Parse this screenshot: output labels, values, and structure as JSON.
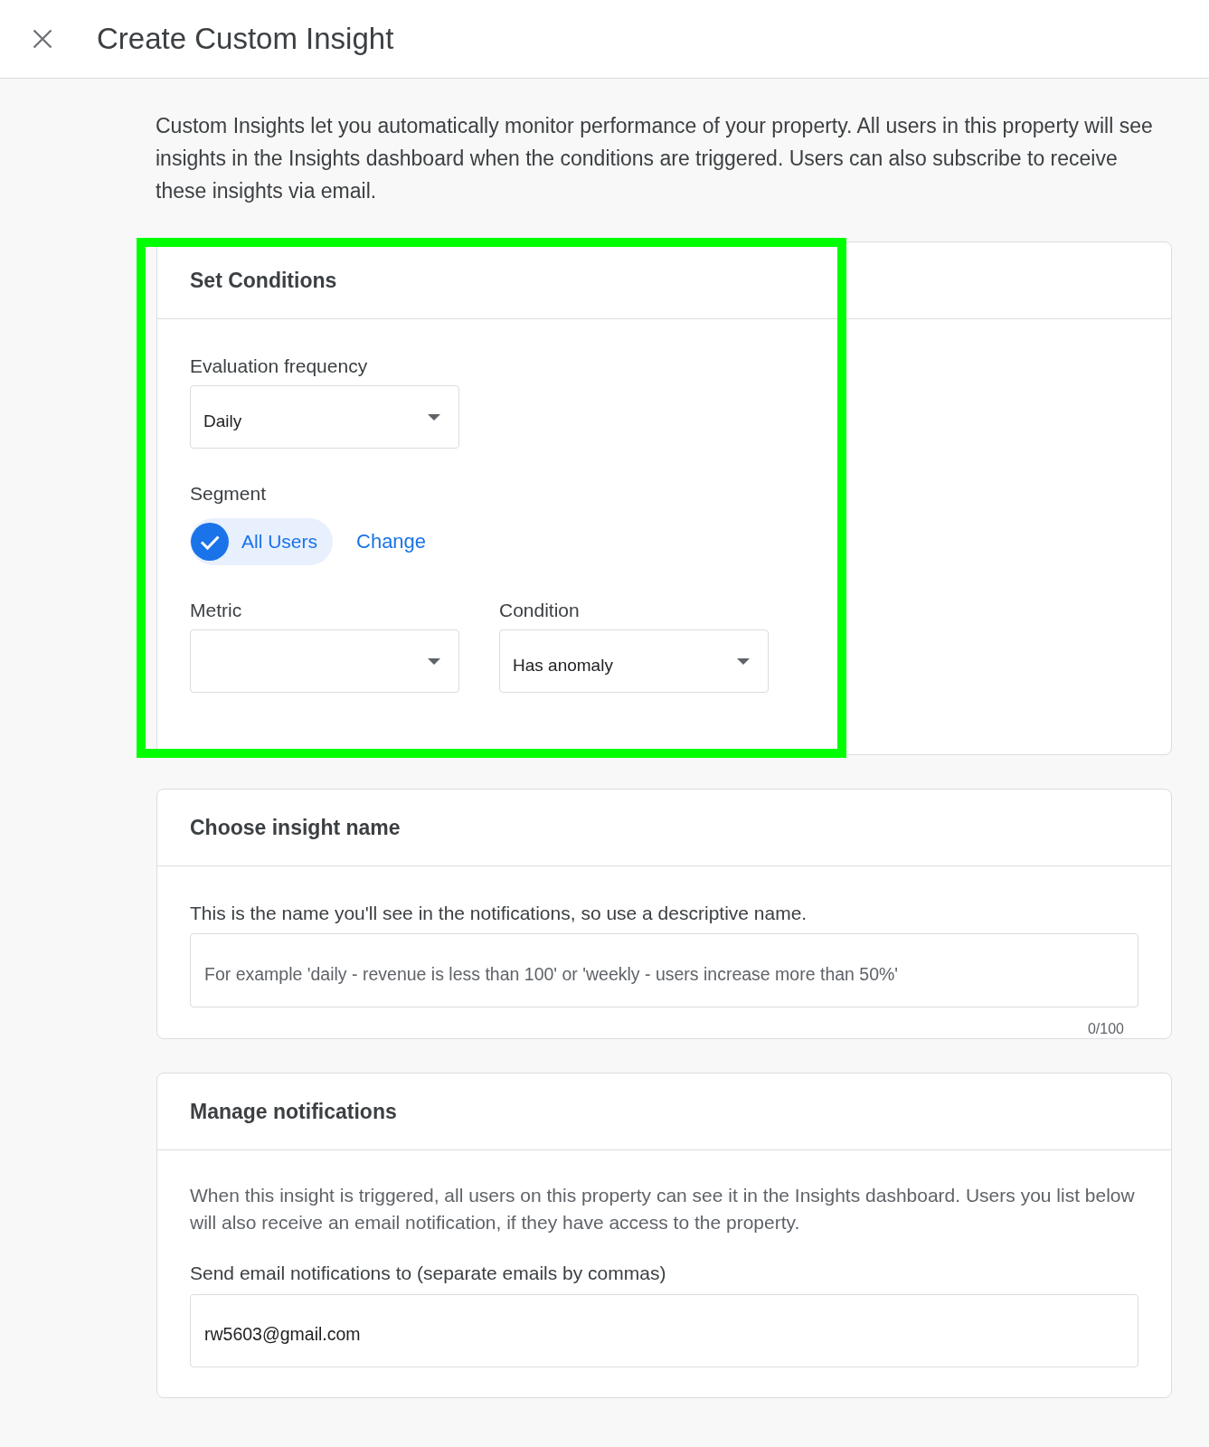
{
  "header": {
    "title": "Create Custom Insight"
  },
  "intro": "Custom Insights let you automatically monitor performance of your property. All users in this property will see insights in the Insights dashboard when the conditions are triggered. Users can also subscribe to receive these insights via email.",
  "sections": [
    {
      "kind": "conditions",
      "title": "Set Conditions",
      "highlighted": true,
      "frequency": {
        "label": "Evaluation frequency",
        "value": "Daily"
      },
      "segment": {
        "label": "Segment",
        "chip": {
          "label": "All Users",
          "checked": true
        },
        "change_link": "Change"
      },
      "metric": {
        "label": "Metric"
      },
      "condition": {
        "label": "Condition",
        "value": "Has anomaly"
      }
    },
    {
      "kind": "name",
      "title": "Choose insight name",
      "highlighted": false,
      "description": "This is the name you'll see in the notifications, so use a descriptive name.",
      "input": {
        "placeholder": "For example 'daily - revenue is less than 100' or 'weekly - users increase more than 50%'",
        "counter": "0/100"
      }
    },
    {
      "kind": "notifications",
      "title": "Manage notifications",
      "highlighted": false,
      "description": "When this insight is triggered, all users on this property can see it in the Insights dashboard. Users you list below will also receive an email notification, if they have access to the property.",
      "email": {
        "label": "Send email notifications to (separate emails by commas)",
        "value": "rw5603@gmail.com"
      }
    }
  ]
}
